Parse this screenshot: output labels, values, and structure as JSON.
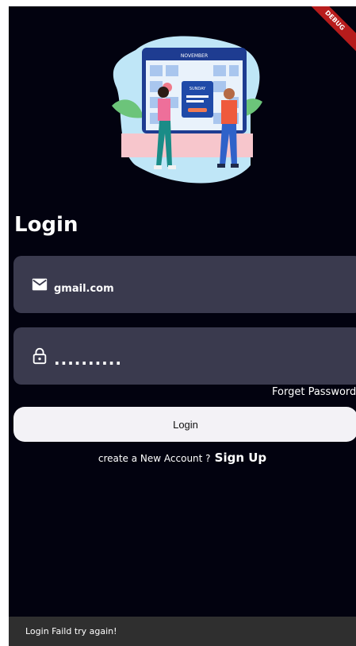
{
  "debug_banner": "DEBUG",
  "illustration": {
    "calendar_month": "NOVEMBER",
    "card_title": "SUNDAY"
  },
  "login": {
    "title": "Login",
    "email_value": "gmail.com",
    "password_value": "..........",
    "forget_password": "Forget Password",
    "login_button": "Login",
    "signup_prompt": "create a New Account ?",
    "signup_link": "Sign Up"
  },
  "snackbar": {
    "message": "Login Faild try again!"
  },
  "icons": {
    "email": "mail-icon",
    "password": "lock-icon"
  },
  "colors": {
    "background": "#02020f",
    "field": "#3a3a4e",
    "button": "#f3f2f6",
    "snackbar": "#2f2f2f"
  }
}
